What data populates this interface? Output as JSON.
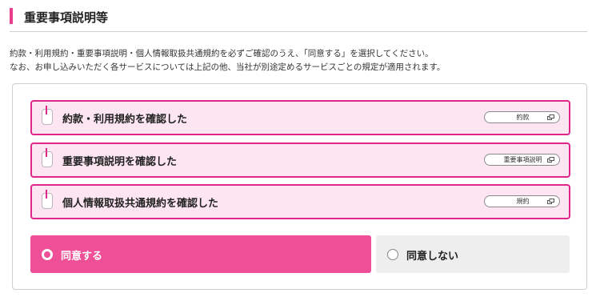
{
  "section": {
    "title": "重要事項説明等"
  },
  "description": {
    "line1": "約款・利用規約・重要事項説明・個人情報取扱共通規約を必ずご確認のうえ、「同意する」を選択してください。",
    "line2": "なお、お申し込みいただく各サービスについては上記の他、当社が別途定めるサービスごとの規定が適用されます。"
  },
  "confirmations": [
    {
      "label": "約款・利用規約を確認した",
      "link_label": "約款"
    },
    {
      "label": "重要事項説明を確認した",
      "link_label": "重要事項説明"
    },
    {
      "label": "個人情報取扱共通規約を確認した",
      "link_label": "規約"
    }
  ],
  "consent": {
    "agree_label": "同意する",
    "disagree_label": "同意しない",
    "selected": "agree"
  },
  "colors": {
    "accent": "#e0268a",
    "row_background": "#fde6f1",
    "agree_background": "#ee4f96",
    "disagree_background": "#eeeeee"
  },
  "icons": {
    "checkbox": "checkbox-icon",
    "external_link": "external-link-icon",
    "radio": "radio-icon"
  }
}
